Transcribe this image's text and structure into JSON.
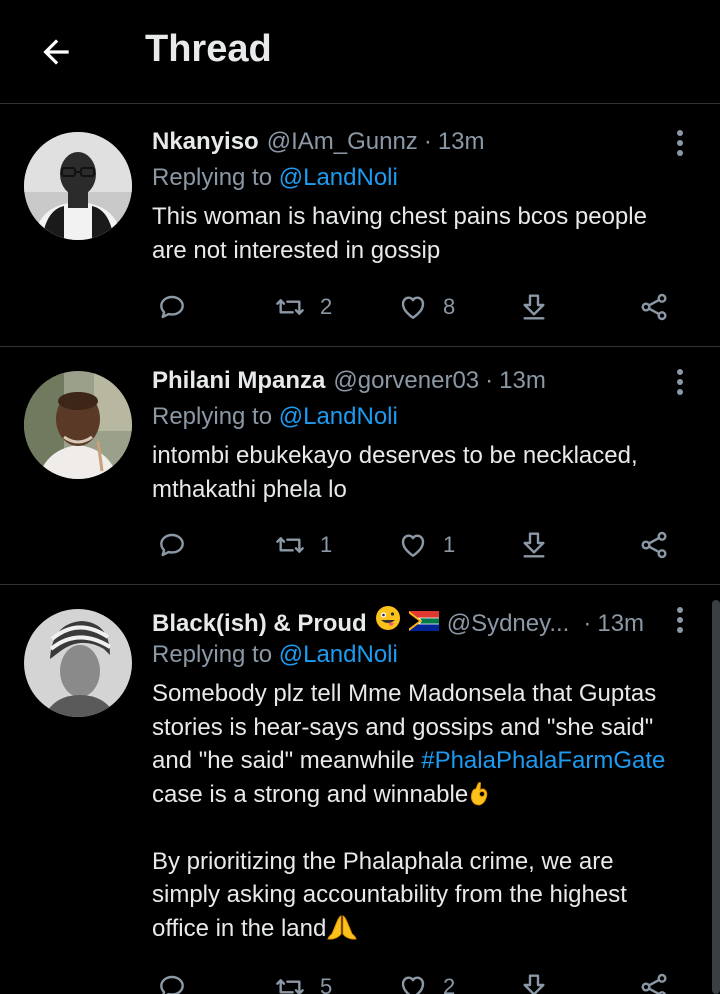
{
  "header": {
    "title": "Thread"
  },
  "colors": {
    "background": "#000000",
    "accent": "#1d9bf0",
    "muted": "#8b98a5",
    "text": "#e7e9ea"
  },
  "tweets": [
    {
      "name": "Nkanyiso",
      "handle": "@IAm_Gunnz",
      "dot": "·",
      "time": "13m",
      "reply_prefix": "Replying to",
      "reply_to": "@LandNoli",
      "lines": [
        "This woman is having chest pains bcos people",
        "are not interested in gossip"
      ],
      "retweets": "2",
      "likes": "8"
    },
    {
      "name": "Philani Mpanza",
      "handle": "@gorvener03",
      "dot": "·",
      "time": "13m",
      "reply_prefix": "Replying to",
      "reply_to": "@LandNoli",
      "lines": [
        "intombi ebukekayo deserves to be necklaced,",
        "mthakathi phela lo"
      ],
      "retweets": "1",
      "likes": "1"
    },
    {
      "name": "Black(ish) & Proud",
      "name_emojis": [
        "zany-face-emoji",
        "south-africa-flag-emoji"
      ],
      "handle": "@Sydney...",
      "dot": "·",
      "time": "13m",
      "reply_prefix": "Replying to",
      "reply_to": "@LandNoli",
      "lines": [
        "Somebody plz tell Mme Madonsela that Guptas",
        "stories is hear-says and gossips and \"she said\"",
        "and \"he said\" meanwhile",
        "#PhalaPhalaFarmGate",
        "case is a strong and winnable",
        "By prioritizing the Phalaphala crime, we are",
        "simply asking accountability from the highest",
        "office in the land"
      ],
      "inline_emojis": [
        "ok-hand-emoji",
        "folded-hands-emoji"
      ],
      "retweets": "5",
      "likes": "2"
    }
  ],
  "icons": [
    "back-arrow-icon",
    "more-options-icon",
    "reply-icon",
    "retweet-icon",
    "like-icon",
    "download-icon",
    "share-icon"
  ]
}
